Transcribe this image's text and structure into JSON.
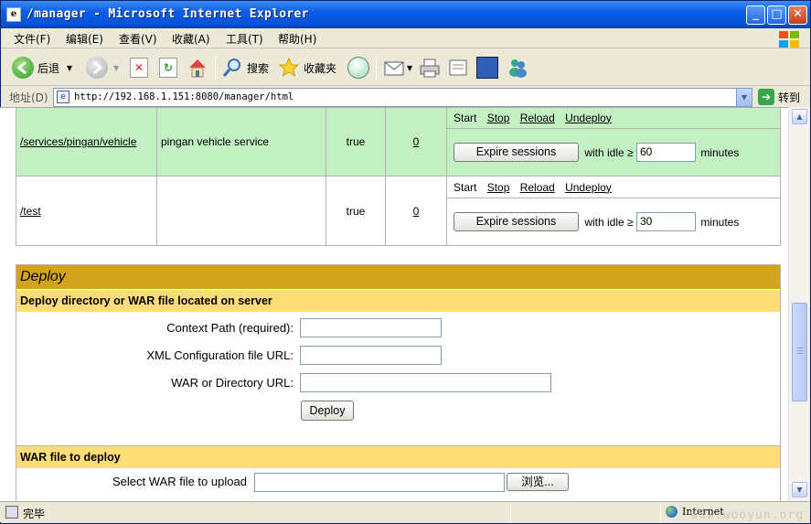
{
  "window": {
    "title": "/manager - Microsoft Internet Explorer",
    "buttons": {
      "minimize": "_",
      "maximize": "□",
      "close": "✕"
    }
  },
  "menu": [
    "文件(F)",
    "编辑(E)",
    "查看(V)",
    "收藏(A)",
    "工具(T)",
    "帮助(H)"
  ],
  "toolbar": {
    "back": "后退",
    "search": "搜索",
    "favorites": "收藏夹"
  },
  "address": {
    "label": "地址(D)",
    "url": "http://192.168.1.151:8080/manager/html",
    "go": "转到"
  },
  "apps": [
    {
      "path": "/services/pingan/vehicle",
      "display_name": "pingan vehicle service",
      "running": "true",
      "sessions": "0",
      "commands": [
        "Start",
        "Stop",
        "Reload",
        "Undeploy"
      ],
      "expire_label": "Expire sessions",
      "idle_label": "with idle ≥",
      "idle_value": "60",
      "minutes_label": "minutes"
    },
    {
      "path": "/test",
      "display_name": "",
      "running": "true",
      "sessions": "0",
      "commands": [
        "Start",
        "Stop",
        "Reload",
        "Undeploy"
      ],
      "expire_label": "Expire sessions",
      "idle_label": "with idle ≥",
      "idle_value": "30",
      "minutes_label": "minutes"
    }
  ],
  "deploy": {
    "title": "Deploy",
    "server_section": "Deploy directory or WAR file located on server",
    "context_path_label": "Context Path (required):",
    "xml_config_label": "XML Configuration file URL:",
    "war_dir_label": "WAR or Directory URL:",
    "deploy_button": "Deploy",
    "war_section": "WAR file to deploy",
    "select_war_label": "Select WAR file to upload",
    "browse_button": "浏览..."
  },
  "status": {
    "text": "完毕",
    "zone": "Internet",
    "watermark": "www.wooyun.org"
  },
  "colors": {
    "title_blue": "#0a5ce8",
    "row_green": "#c3f0c3",
    "deploy_header": "#d2a41c",
    "section_header": "#ffdc75"
  }
}
